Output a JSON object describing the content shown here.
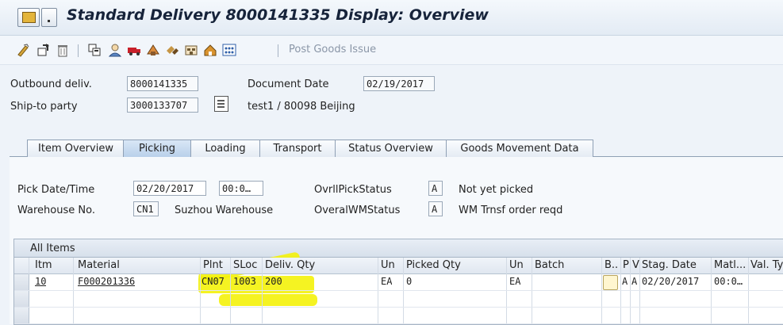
{
  "window": {
    "title": "Standard Delivery 8000141335 Display: Overview"
  },
  "toolbar": {
    "post_goods_issue": "Post Goods Issue"
  },
  "header": {
    "outbound_label": "Outbound deliv.",
    "outbound_value": "8000141335",
    "doc_date_label": "Document Date",
    "doc_date_value": "02/19/2017",
    "ship_to_label": "Ship-to party",
    "ship_to_value": "3000133707",
    "ship_to_desc": "test1 / 80098 Beijing"
  },
  "tabs": [
    {
      "label": "Item Overview"
    },
    {
      "label": "Picking"
    },
    {
      "label": "Loading"
    },
    {
      "label": "Transport"
    },
    {
      "label": "Status Overview"
    },
    {
      "label": "Goods Movement Data"
    }
  ],
  "picking": {
    "pick_date_label": "Pick Date/Time",
    "pick_date_value": "02/20/2017",
    "pick_time_value": "00:0…",
    "ovrl_pick_label": "OvrllPickStatus",
    "ovrl_pick_value": "A",
    "ovrl_pick_text": "Not yet picked",
    "warehouse_label": "Warehouse No.",
    "warehouse_value": "CN1",
    "warehouse_text": "Suzhou Warehouse",
    "wm_status_label": "OveralWMStatus",
    "wm_status_value": "A",
    "wm_status_text": "WM Trnsf order reqd"
  },
  "table": {
    "title": "All Items",
    "columns": [
      "Itm",
      "Material",
      "Plnt",
      "SLoc",
      "Deliv. Qty",
      "Un",
      "Picked Qty",
      "Un",
      "Batch",
      "B..",
      "P",
      "V",
      "Stag. Date",
      "Matl...",
      "Val. Ty"
    ],
    "rows": [
      {
        "itm": "10",
        "material": "F000201336",
        "plnt": "CN07",
        "sloc": "1003",
        "deliv_qty": "200",
        "un": "EA",
        "picked_qty": "0",
        "un2": "EA",
        "batch": "",
        "p": "A",
        "v": "A",
        "stag_date": "02/20/2017",
        "matl": "00:0…"
      }
    ]
  },
  "colors": {
    "highlight": "#f4f20a",
    "accent": "#16233a"
  }
}
